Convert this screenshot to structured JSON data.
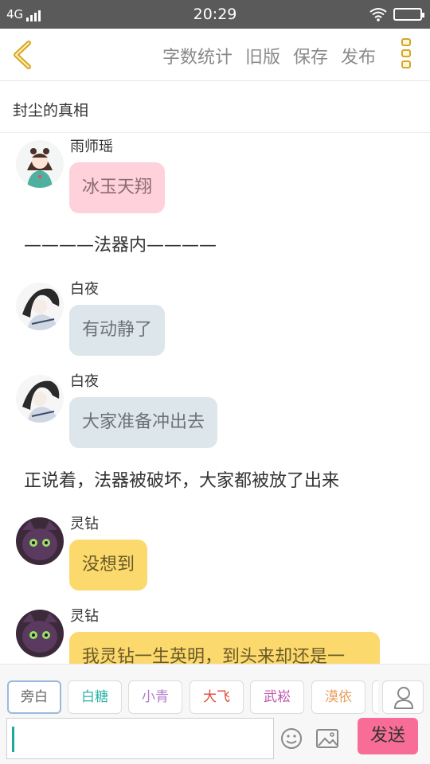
{
  "status_bar": {
    "network": "4G",
    "time": "20:29"
  },
  "toolbar": {
    "actions": [
      "字数统计",
      "旧版",
      "保存",
      "发布"
    ]
  },
  "title": "封尘的真相",
  "messages": [
    {
      "speaker": "雨师瑶",
      "text": "冰玉天翔",
      "style": "pink"
    },
    {
      "narration": "————法器内————"
    },
    {
      "speaker": "白夜",
      "text": "有动静了",
      "style": "blue"
    },
    {
      "speaker": "白夜",
      "text": "大家准备冲出去",
      "style": "blue"
    },
    {
      "narration": "正说着，法器被破坏，大家都被放了出来"
    },
    {
      "speaker": "灵钻",
      "text": "没想到",
      "style": "yellow"
    },
    {
      "speaker": "灵钻",
      "text": "我灵钻一生英明，到头来却还是一",
      "style": "yellow"
    }
  ],
  "roles": [
    {
      "label": "旁白",
      "color": "#666666",
      "selected": true
    },
    {
      "label": "白糖",
      "color": "#2bb3a6"
    },
    {
      "label": "小青",
      "color": "#b07cc8"
    },
    {
      "label": "大飞",
      "color": "#e04a3a"
    },
    {
      "label": "武崧",
      "color": "#c058b0"
    },
    {
      "label": "漠依",
      "color": "#e8a060"
    }
  ],
  "input": {
    "value": "",
    "send_label": "发送"
  },
  "colors": {
    "send": "#f76d98",
    "accent": "#d6a52a"
  }
}
